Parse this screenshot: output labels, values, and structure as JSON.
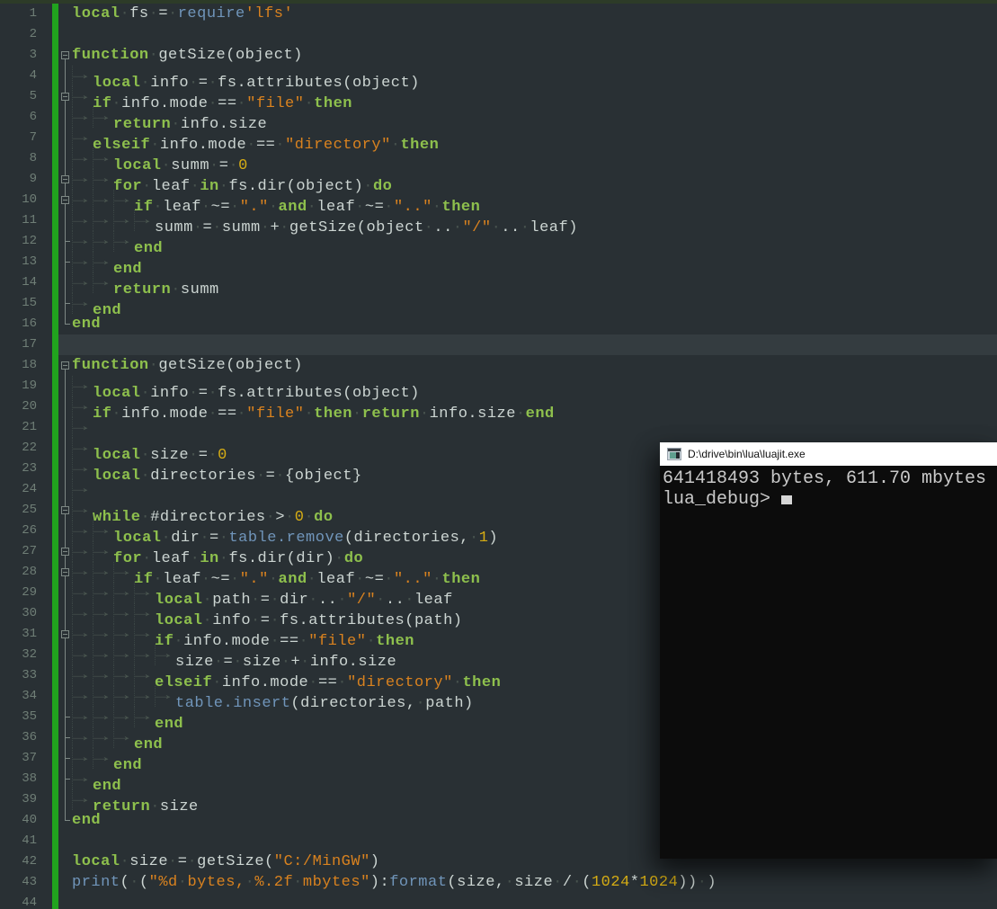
{
  "console": {
    "title": "D:\\drive\\bin\\lua\\luajit.exe",
    "lines": [
      "641418493 bytes, 611.70 mbytes",
      "lua_debug> "
    ],
    "cursor_visible": true,
    "colors": {
      "titlebar_bg": "#ffffff",
      "body_bg": "#0c0c0c",
      "text": "#c9c9c9"
    }
  },
  "editor": {
    "language": "lua",
    "current_line": 17,
    "colors": {
      "background": "#293034",
      "change_bar_green": "#21a31e",
      "keyword": "#8ec04d",
      "string": "#d9821f",
      "library": "#7095ba",
      "number": "#d5ac14",
      "text": "#ccd5d2",
      "line_number": "#6f7e76",
      "current_line_bg": "#343c40"
    },
    "lines": [
      {
        "n": 1,
        "fold": "",
        "ind": 0,
        "segs": [
          [
            "k",
            "local"
          ],
          [
            "p",
            " fs = "
          ],
          [
            "b",
            "require"
          ],
          [
            "s",
            "'lfs'"
          ]
        ]
      },
      {
        "n": 2,
        "fold": "",
        "ind": 0,
        "segs": []
      },
      {
        "n": 3,
        "fold": "box",
        "ind": 0,
        "segs": [
          [
            "k",
            "function"
          ],
          [
            "p",
            " getSize(object)"
          ]
        ]
      },
      {
        "n": 4,
        "fold": "v",
        "ind": 1,
        "segs": [
          [
            "k",
            "local"
          ],
          [
            "p",
            " info = fs.attributes(object)"
          ]
        ]
      },
      {
        "n": 5,
        "fold": "boxv",
        "ind": 1,
        "segs": [
          [
            "k",
            "if"
          ],
          [
            "p",
            " info.mode == "
          ],
          [
            "s",
            "\"file\""
          ],
          [
            "p",
            " "
          ],
          [
            "k",
            "then"
          ]
        ]
      },
      {
        "n": 6,
        "fold": "v",
        "ind": 2,
        "segs": [
          [
            "k",
            "return"
          ],
          [
            "p",
            " info.size"
          ]
        ]
      },
      {
        "n": 7,
        "fold": "v",
        "ind": 1,
        "segs": [
          [
            "k",
            "elseif"
          ],
          [
            "p",
            " info.mode == "
          ],
          [
            "s",
            "\"directory\""
          ],
          [
            "p",
            " "
          ],
          [
            "k",
            "then"
          ]
        ]
      },
      {
        "n": 8,
        "fold": "v",
        "ind": 2,
        "segs": [
          [
            "k",
            "local"
          ],
          [
            "p",
            " summ = "
          ],
          [
            "n_",
            "0"
          ]
        ]
      },
      {
        "n": 9,
        "fold": "boxv",
        "ind": 2,
        "segs": [
          [
            "k",
            "for"
          ],
          [
            "p",
            " leaf "
          ],
          [
            "k",
            "in"
          ],
          [
            "p",
            " fs.dir(object) "
          ],
          [
            "k",
            "do"
          ]
        ]
      },
      {
        "n": 10,
        "fold": "boxv",
        "ind": 3,
        "segs": [
          [
            "k",
            "if"
          ],
          [
            "p",
            " leaf ~= "
          ],
          [
            "s",
            "\".\""
          ],
          [
            "p",
            " "
          ],
          [
            "k",
            "and"
          ],
          [
            "p",
            " leaf ~= "
          ],
          [
            "s",
            "\"..\""
          ],
          [
            "p",
            " "
          ],
          [
            "k",
            "then"
          ]
        ]
      },
      {
        "n": 11,
        "fold": "v",
        "ind": 4,
        "segs": [
          [
            "p",
            "summ = summ + getSize(object .. "
          ],
          [
            "s",
            "\"/\""
          ],
          [
            "p",
            " .. leaf)"
          ]
        ]
      },
      {
        "n": 12,
        "fold": "t",
        "ind": 3,
        "segs": [
          [
            "k",
            "end"
          ]
        ]
      },
      {
        "n": 13,
        "fold": "t",
        "ind": 2,
        "segs": [
          [
            "k",
            "end"
          ]
        ]
      },
      {
        "n": 14,
        "fold": "v",
        "ind": 2,
        "segs": [
          [
            "k",
            "return"
          ],
          [
            "p",
            " summ"
          ]
        ]
      },
      {
        "n": 15,
        "fold": "t",
        "ind": 1,
        "segs": [
          [
            "k",
            "end"
          ]
        ]
      },
      {
        "n": 16,
        "fold": "c",
        "ind": 0,
        "segs": [
          [
            "k",
            "end"
          ]
        ]
      },
      {
        "n": 17,
        "fold": "",
        "ind": 0,
        "segs": []
      },
      {
        "n": 18,
        "fold": "box",
        "ind": 0,
        "segs": [
          [
            "k",
            "function"
          ],
          [
            "p",
            " getSize(object)"
          ]
        ]
      },
      {
        "n": 19,
        "fold": "v",
        "ind": 1,
        "segs": [
          [
            "k",
            "local"
          ],
          [
            "p",
            " info = fs.attributes(object)"
          ]
        ]
      },
      {
        "n": 20,
        "fold": "v",
        "ind": 1,
        "segs": [
          [
            "k",
            "if"
          ],
          [
            "p",
            " info.mode == "
          ],
          [
            "s",
            "\"file\""
          ],
          [
            "p",
            " "
          ],
          [
            "k",
            "then"
          ],
          [
            "p",
            " "
          ],
          [
            "k",
            "return"
          ],
          [
            "p",
            " info.size "
          ],
          [
            "k",
            "end"
          ]
        ]
      },
      {
        "n": 21,
        "fold": "v",
        "ind": 1,
        "segs": []
      },
      {
        "n": 22,
        "fold": "v",
        "ind": 1,
        "segs": [
          [
            "k",
            "local"
          ],
          [
            "p",
            " size = "
          ],
          [
            "n_",
            "0"
          ]
        ]
      },
      {
        "n": 23,
        "fold": "v",
        "ind": 1,
        "segs": [
          [
            "k",
            "local"
          ],
          [
            "p",
            " directories = {object}"
          ]
        ]
      },
      {
        "n": 24,
        "fold": "v",
        "ind": 1,
        "segs": []
      },
      {
        "n": 25,
        "fold": "boxv",
        "ind": 1,
        "segs": [
          [
            "k",
            "while"
          ],
          [
            "p",
            " #directories > "
          ],
          [
            "n_",
            "0"
          ],
          [
            "p",
            " "
          ],
          [
            "k",
            "do"
          ]
        ]
      },
      {
        "n": 26,
        "fold": "v",
        "ind": 2,
        "segs": [
          [
            "k",
            "local"
          ],
          [
            "p",
            " dir = "
          ],
          [
            "b",
            "table.remove"
          ],
          [
            "p",
            "(directories, "
          ],
          [
            "n_",
            "1"
          ],
          [
            "p",
            ")"
          ]
        ]
      },
      {
        "n": 27,
        "fold": "boxv",
        "ind": 2,
        "segs": [
          [
            "k",
            "for"
          ],
          [
            "p",
            " leaf "
          ],
          [
            "k",
            "in"
          ],
          [
            "p",
            " fs.dir(dir) "
          ],
          [
            "k",
            "do"
          ]
        ]
      },
      {
        "n": 28,
        "fold": "boxv",
        "ind": 3,
        "segs": [
          [
            "k",
            "if"
          ],
          [
            "p",
            " leaf ~= "
          ],
          [
            "s",
            "\".\""
          ],
          [
            "p",
            " "
          ],
          [
            "k",
            "and"
          ],
          [
            "p",
            " leaf ~= "
          ],
          [
            "s",
            "\"..\""
          ],
          [
            "p",
            " "
          ],
          [
            "k",
            "then"
          ]
        ]
      },
      {
        "n": 29,
        "fold": "v",
        "ind": 4,
        "segs": [
          [
            "k",
            "local"
          ],
          [
            "p",
            " path = dir .. "
          ],
          [
            "s",
            "\"/\""
          ],
          [
            "p",
            " .. leaf"
          ]
        ]
      },
      {
        "n": 30,
        "fold": "v",
        "ind": 4,
        "segs": [
          [
            "k",
            "local"
          ],
          [
            "p",
            " info = fs.attributes(path)"
          ]
        ]
      },
      {
        "n": 31,
        "fold": "boxv",
        "ind": 4,
        "segs": [
          [
            "k",
            "if"
          ],
          [
            "p",
            " info.mode == "
          ],
          [
            "s",
            "\"file\""
          ],
          [
            "p",
            " "
          ],
          [
            "k",
            "then"
          ]
        ]
      },
      {
        "n": 32,
        "fold": "v",
        "ind": 5,
        "segs": [
          [
            "p",
            "size = size + info.size"
          ]
        ]
      },
      {
        "n": 33,
        "fold": "v",
        "ind": 4,
        "segs": [
          [
            "k",
            "elseif"
          ],
          [
            "p",
            " info.mode == "
          ],
          [
            "s",
            "\"directory\""
          ],
          [
            "p",
            " "
          ],
          [
            "k",
            "then"
          ]
        ]
      },
      {
        "n": 34,
        "fold": "v",
        "ind": 5,
        "segs": [
          [
            "b",
            "table.insert"
          ],
          [
            "p",
            "(directories, path)"
          ]
        ]
      },
      {
        "n": 35,
        "fold": "t",
        "ind": 4,
        "segs": [
          [
            "k",
            "end"
          ]
        ]
      },
      {
        "n": 36,
        "fold": "t",
        "ind": 3,
        "segs": [
          [
            "k",
            "end"
          ]
        ]
      },
      {
        "n": 37,
        "fold": "t",
        "ind": 2,
        "segs": [
          [
            "k",
            "end"
          ]
        ]
      },
      {
        "n": 38,
        "fold": "t",
        "ind": 1,
        "segs": [
          [
            "k",
            "end"
          ]
        ]
      },
      {
        "n": 39,
        "fold": "v",
        "ind": 1,
        "segs": [
          [
            "k",
            "return"
          ],
          [
            "p",
            " size"
          ]
        ]
      },
      {
        "n": 40,
        "fold": "c",
        "ind": 0,
        "segs": [
          [
            "k",
            "end"
          ]
        ]
      },
      {
        "n": 41,
        "fold": "",
        "ind": 0,
        "segs": []
      },
      {
        "n": 42,
        "fold": "",
        "ind": 0,
        "segs": [
          [
            "k",
            "local"
          ],
          [
            "p",
            " size = getSize("
          ],
          [
            "s",
            "\"C:/MinGW\""
          ],
          [
            "p",
            ")"
          ]
        ]
      },
      {
        "n": 43,
        "fold": "",
        "ind": 0,
        "segs": [
          [
            "b",
            "print"
          ],
          [
            "p",
            "( ("
          ],
          [
            "s",
            "\"%d bytes, %.2f mbytes\""
          ],
          [
            "p",
            "):"
          ],
          [
            "b",
            "format"
          ],
          [
            "p",
            "(size, size / ("
          ],
          [
            "n_",
            "1024"
          ],
          [
            "p",
            "*"
          ],
          [
            "n_",
            "1024"
          ],
          [
            "p",
            ")) )"
          ]
        ]
      },
      {
        "n": 44,
        "fold": "",
        "ind": 0,
        "segs": []
      }
    ]
  }
}
